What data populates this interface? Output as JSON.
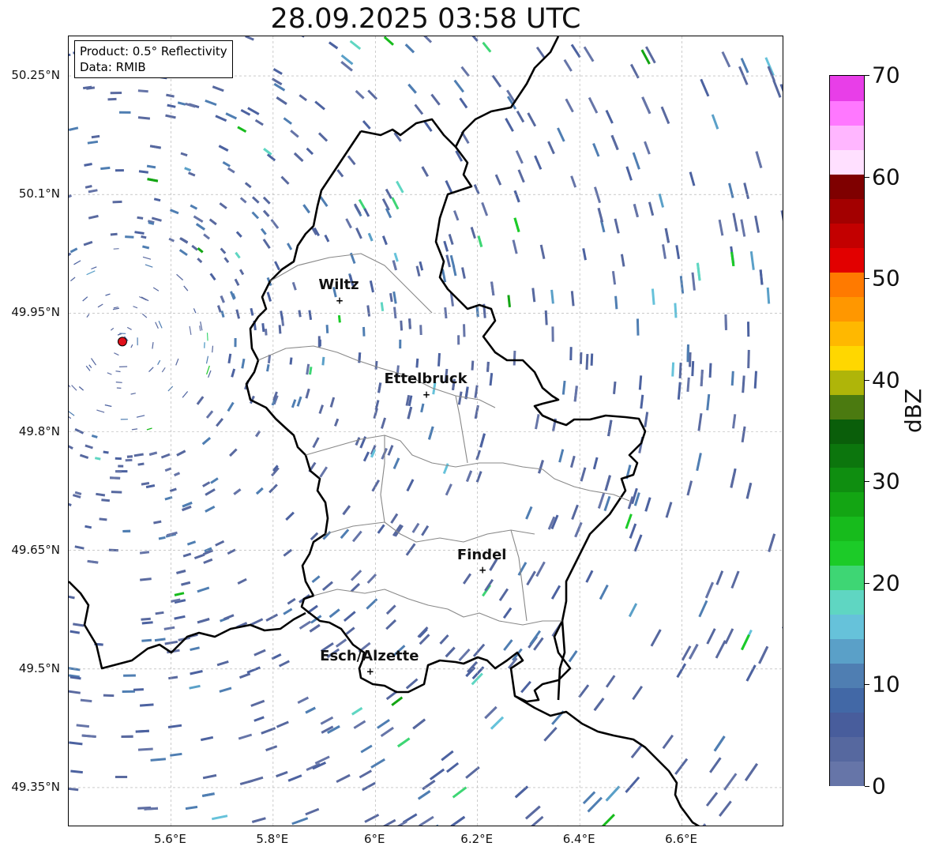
{
  "title": "28.09.2025 03:58 UTC",
  "info": {
    "product": "Product: 0.5° Reflectivity",
    "source": "Data: RMIB"
  },
  "lat_labels": [
    "50.25°N",
    "50.1°N",
    "49.95°N",
    "49.8°N",
    "49.65°N",
    "49.5°N",
    "49.35°N"
  ],
  "lon_labels": [
    "5.6°E",
    "5.8°E",
    "6°E",
    "6.2°E",
    "6.4°E",
    "6.6°E"
  ],
  "cities": [
    {
      "name": "Wiltz",
      "lon": 5.93,
      "lat": 49.967
    },
    {
      "name": "Ettelbruck",
      "lon": 6.1,
      "lat": 49.848
    },
    {
      "name": "Findel",
      "lon": 6.21,
      "lat": 49.626
    },
    {
      "name": "Esch/Alzette",
      "lon": 5.99,
      "lat": 49.498
    }
  ],
  "radar_site": {
    "lon": 5.505,
    "lat": 49.914,
    "color": "#e0101a"
  },
  "colorbar": {
    "label": "dBZ",
    "ticks": [
      "0",
      "10",
      "20",
      "30",
      "40",
      "50",
      "60",
      "70"
    ],
    "min": 0,
    "max": 70,
    "colors": [
      "#6675a8",
      "#56689f",
      "#485d9c",
      "#4268a6",
      "#4f7eb2",
      "#5aa0c8",
      "#66c2da",
      "#5fd6c2",
      "#3ed674",
      "#1ccb28",
      "#17bb1c",
      "#13a513",
      "#0f8e10",
      "#0c760d",
      "#0a5e0a",
      "#4b7a10",
      "#afb509",
      "#ffd700",
      "#ffb800",
      "#ff9700",
      "#ff7a00",
      "#e20000",
      "#c30000",
      "#a30000",
      "#7f0000",
      "#ffe0ff",
      "#ffb6ff",
      "#ff78ff",
      "#e83ee8"
    ]
  },
  "map": {
    "lon_range": [
      5.4,
      6.8
    ],
    "lat_range": [
      49.3,
      50.3
    ]
  }
}
